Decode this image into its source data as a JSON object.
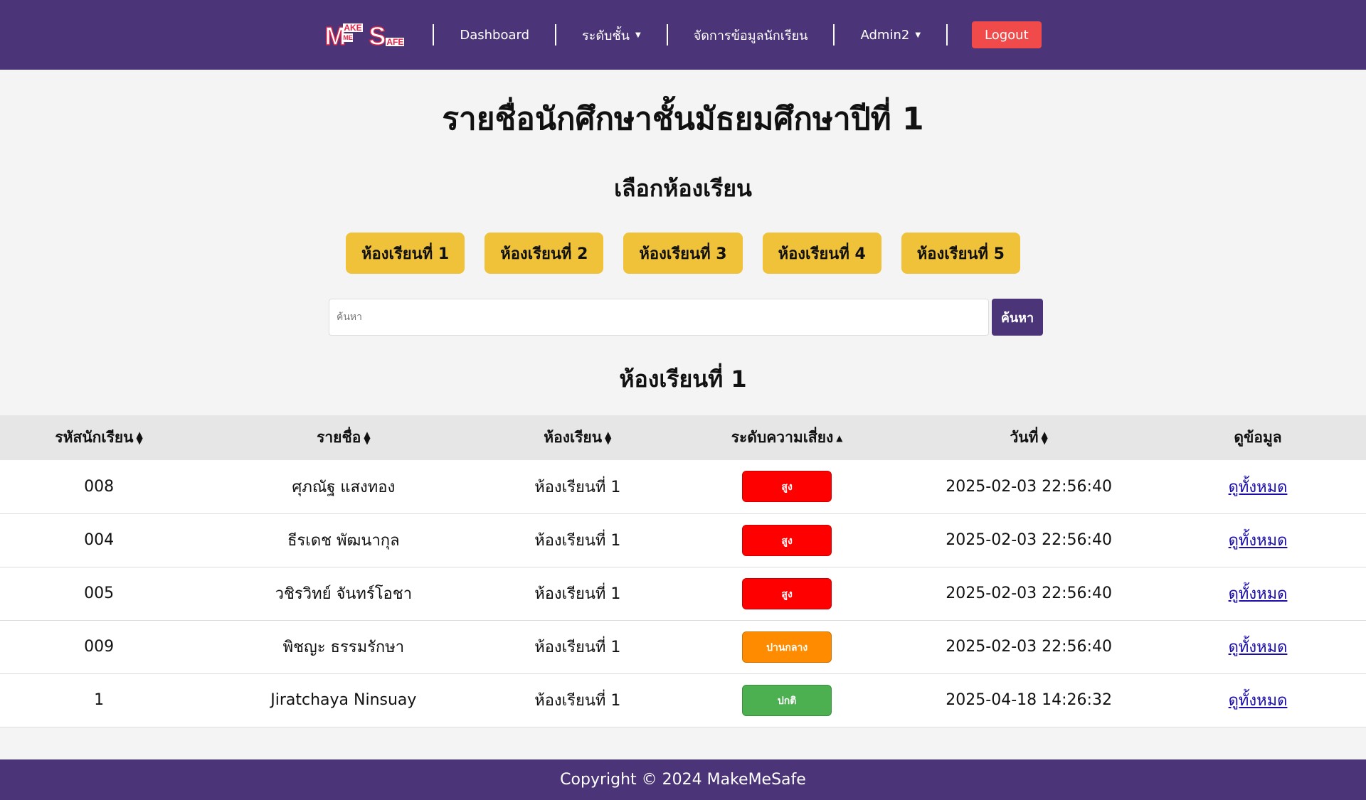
{
  "navbar": {
    "logo": {
      "m": "M",
      "ake": "AKE",
      "me": "ME",
      "s": "S",
      "afe": "AFE"
    },
    "items": [
      {
        "label": "Dashboard",
        "dropdown": false
      },
      {
        "label": "ระดับชั้น",
        "dropdown": true
      },
      {
        "label": "จัดการข้อมูลนักเรียน",
        "dropdown": false
      },
      {
        "label": "Admin2",
        "dropdown": true
      }
    ],
    "caret": "▼",
    "logout_label": "Logout"
  },
  "page": {
    "title": "รายชื่อนักศึกษาชั้นมัธยมศึกษาปีที่ 1",
    "choose_room_title": "เลือกห้องเรียน",
    "room_buttons": [
      "ห้องเรียนที่ 1",
      "ห้องเรียนที่ 2",
      "ห้องเรียนที่ 3",
      "ห้องเรียนที่ 4",
      "ห้องเรียนที่ 5"
    ],
    "search": {
      "placeholder": "ค้นหา",
      "value": "",
      "button_label": "ค้นหา"
    },
    "current_room": "ห้องเรียนที่ 1"
  },
  "table": {
    "headers": [
      "รหัสนักเรียน",
      "รายชื่อ",
      "ห้องเรียน",
      "ระดับความเสี่ยง",
      "วันที่",
      "ดูข้อมูล"
    ],
    "rows": [
      {
        "id": "008",
        "name": "ศุภณัฐ แสงทอง",
        "room": "ห้องเรียนที่ 1",
        "risk": "สูง",
        "risk_level": "high",
        "date": "2025-02-03 22:56:40",
        "link": "ดูทั้งหมด"
      },
      {
        "id": "004",
        "name": "ธีรเดช พัฒนากุล",
        "room": "ห้องเรียนที่ 1",
        "risk": "สูง",
        "risk_level": "high",
        "date": "2025-02-03 22:56:40",
        "link": "ดูทั้งหมด"
      },
      {
        "id": "005",
        "name": "วชิรวิทย์ จันทร์โอชา",
        "room": "ห้องเรียนที่ 1",
        "risk": "สูง",
        "risk_level": "high",
        "date": "2025-02-03 22:56:40",
        "link": "ดูทั้งหมด"
      },
      {
        "id": "009",
        "name": "พิชญะ ธรรมรักษา",
        "room": "ห้องเรียนที่ 1",
        "risk": "ปานกลาง",
        "risk_level": "mid",
        "date": "2025-02-03 22:56:40",
        "link": "ดูทั้งหมด"
      },
      {
        "id": "1",
        "name": "Jiratchaya Ninsuay",
        "room": "ห้องเรียนที่ 1",
        "risk": "ปกติ",
        "risk_level": "norm",
        "date": "2025-04-18 14:26:32",
        "link": "ดูทั้งหมด"
      }
    ]
  },
  "colors": {
    "brand": "#4b3478",
    "accent": "#f0c23a",
    "logout": "#f14a4a",
    "risk_high": "#ff0000",
    "risk_mid": "#ff8c00",
    "risk_norm": "#4caf50"
  },
  "footer": {
    "text": "Copyright © 2024 MakeMeSafe"
  }
}
